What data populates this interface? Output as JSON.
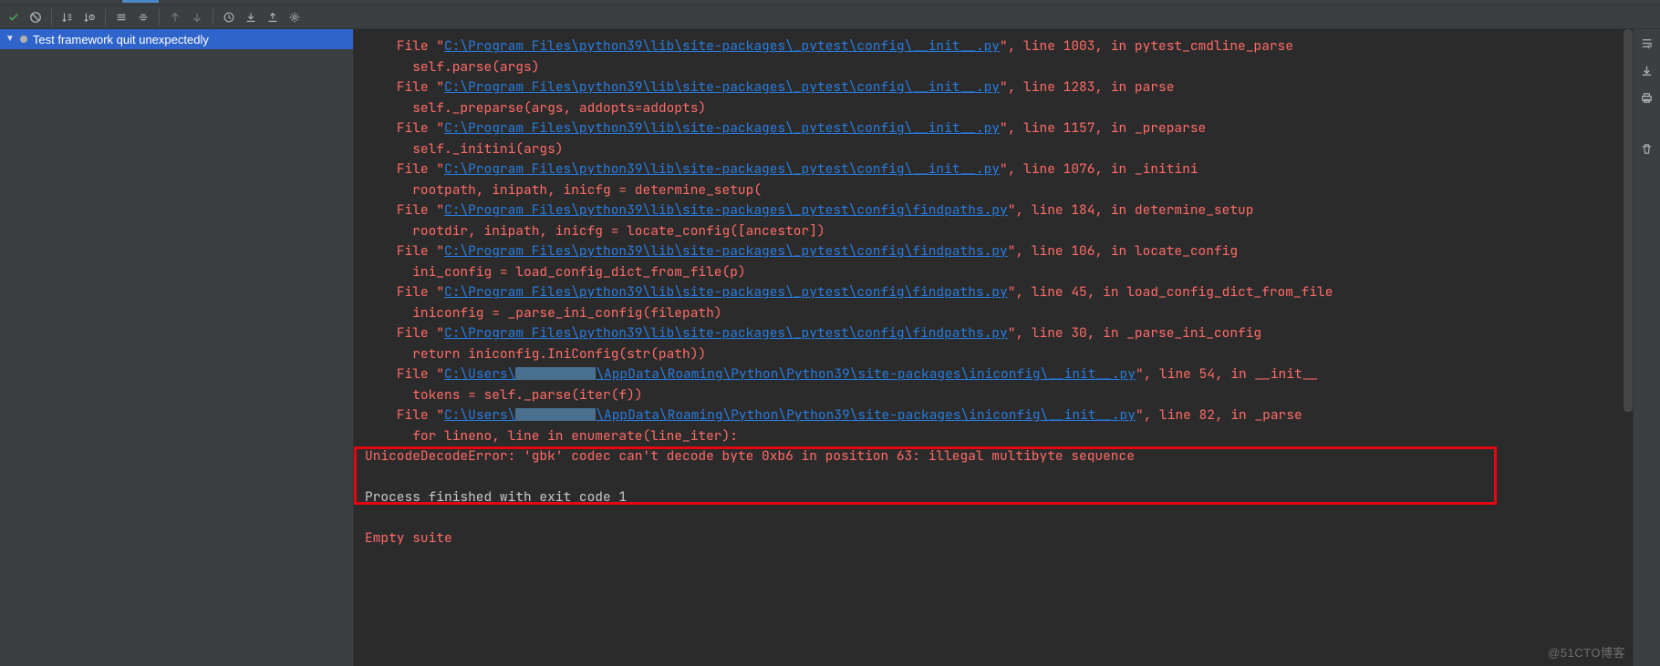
{
  "test_panel": {
    "message": "Test framework quit unexpectedly"
  },
  "traceback": [
    {
      "path": "C:\\Program Files\\python39\\lib\\site-packages\\_pytest\\config\\__init__.py",
      "line_no": "1003",
      "func": "pytest_cmdline_parse",
      "code": "self.parse(args)"
    },
    {
      "path": "C:\\Program Files\\python39\\lib\\site-packages\\_pytest\\config\\__init__.py",
      "line_no": "1283",
      "func": "parse",
      "code": "self._preparse(args, addopts=addopts)"
    },
    {
      "path": "C:\\Program Files\\python39\\lib\\site-packages\\_pytest\\config\\__init__.py",
      "line_no": "1157",
      "func": "_preparse",
      "code": "self._initini(args)"
    },
    {
      "path": "C:\\Program Files\\python39\\lib\\site-packages\\_pytest\\config\\__init__.py",
      "line_no": "1076",
      "func": "_initini",
      "code": "rootpath, inipath, inicfg = determine_setup("
    },
    {
      "path": "C:\\Program Files\\python39\\lib\\site-packages\\_pytest\\config\\findpaths.py",
      "line_no": "184",
      "func": "determine_setup",
      "code": "rootdir, inipath, inicfg = locate_config([ancestor])"
    },
    {
      "path": "C:\\Program Files\\python39\\lib\\site-packages\\_pytest\\config\\findpaths.py",
      "line_no": "106",
      "func": "locate_config",
      "code": "ini_config = load_config_dict_from_file(p)"
    },
    {
      "path": "C:\\Program Files\\python39\\lib\\site-packages\\_pytest\\config\\findpaths.py",
      "line_no": "45",
      "func": "load_config_dict_from_file",
      "code": "iniconfig = _parse_ini_config(filepath)"
    },
    {
      "path": "C:\\Program Files\\python39\\lib\\site-packages\\_pytest\\config\\findpaths.py",
      "line_no": "30",
      "func": "_parse_ini_config",
      "code": "return iniconfig.IniConfig(str(path))"
    },
    {
      "path_prefix": "C:\\Users\\",
      "path_suffix": "\\AppData\\Roaming\\Python\\Python39\\site-packages\\iniconfig\\__init__.py",
      "line_no": "54",
      "func": "__init__",
      "code": "tokens = self._parse(iter(f))",
      "redacted": true
    },
    {
      "path_prefix": "C:\\Users\\",
      "path_suffix": "\\AppData\\Roaming\\Python\\Python39\\site-packages\\iniconfig\\__init__.py",
      "line_no": "82",
      "func": "_parse",
      "code": "for lineno, line in enumerate(line_iter):",
      "redacted": true
    }
  ],
  "error_line": "UnicodeDecodeError: 'gbk' codec can't decode byte 0xb6 in position 63: illegal multibyte sequence",
  "process_line": "Process finished with exit code 1",
  "empty_suite": "Empty suite",
  "file_word": "File",
  "quote": "\"",
  "line_word": ", line ",
  "in_word": ", in ",
  "watermark": "@51CTO博客"
}
